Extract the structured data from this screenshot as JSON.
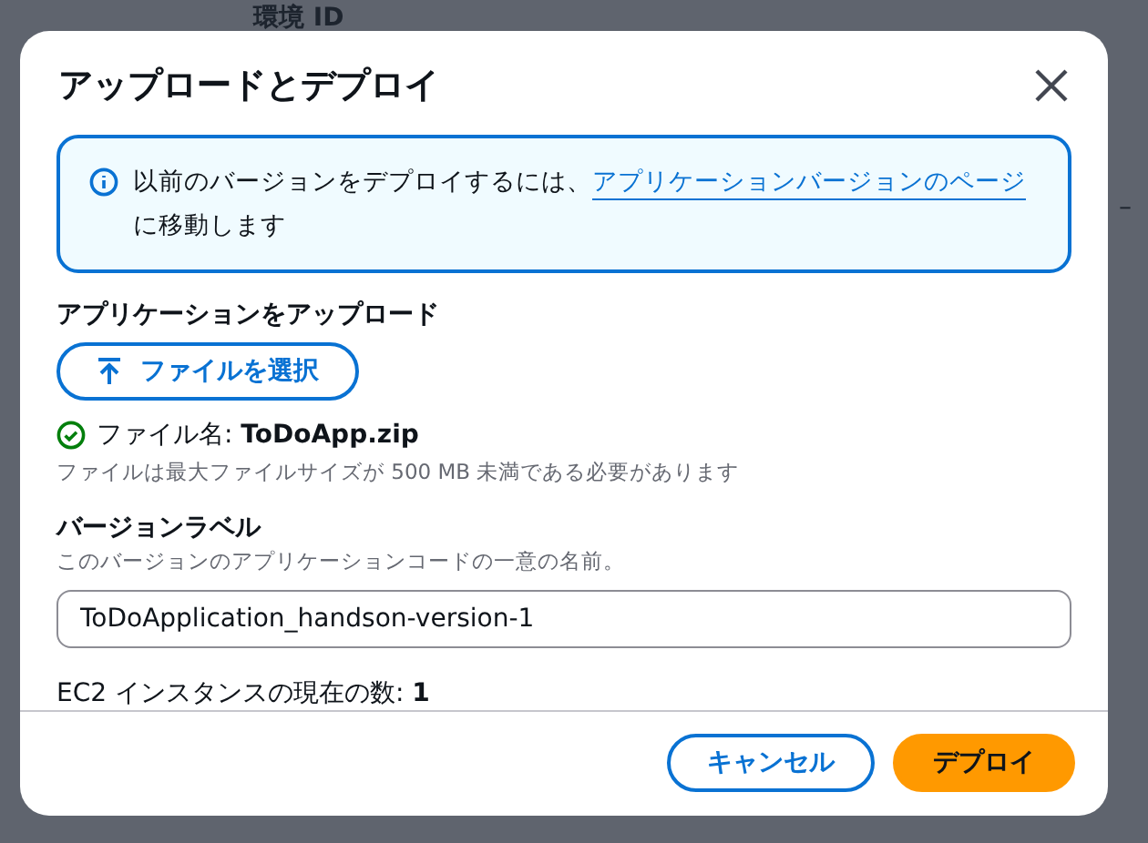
{
  "background": {
    "texts": [
      "環境 ID",
      "–"
    ]
  },
  "dialog": {
    "title": "アップロードとデプロイ",
    "alert": {
      "text": "以前のバージョンをデプロイするには、",
      "link": "アプリケーションバージョンのページ",
      "after": " に移動します"
    },
    "upload": {
      "heading": "アプリケーションをアップロード",
      "button": "ファイルを選択",
      "file_label": "ファイル名: ",
      "file_name": "ToDoApp.zip",
      "hint": "ファイルは最大ファイルサイズが 500 MB 未満である必要があります"
    },
    "version": {
      "label": "バージョンラベル",
      "description": "このバージョンのアプリケーションコードの一意の名前。",
      "value": "ToDoApplication_handson-version-1"
    },
    "instances": {
      "label": "EC2 インスタンスの現在の数: ",
      "value": "1"
    },
    "buttons": [
      {
        "label": "キャンセル",
        "kind": "secondary"
      },
      {
        "label": "デプロイ",
        "kind": "primary"
      }
    ]
  }
}
